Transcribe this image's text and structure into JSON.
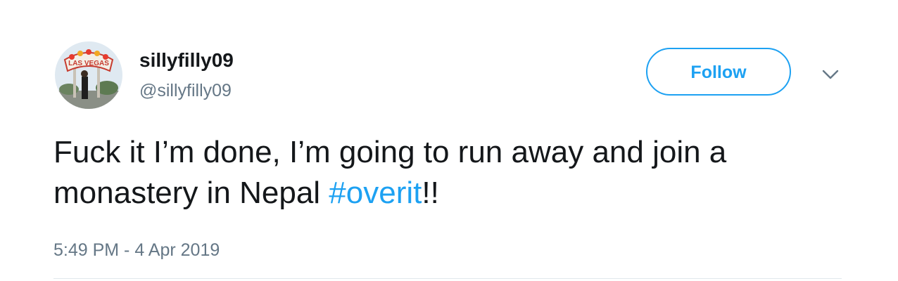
{
  "tweet": {
    "display_name": "sillyfilly09",
    "handle": "@sillyfilly09",
    "follow_label": "Follow",
    "text_before": "Fuck it I’m done, I’m going to run away and join a monastery in Nepal ",
    "hashtag": "#overit",
    "text_after": "!!",
    "timestamp": "5:49 PM - 4 Apr 2019",
    "avatar_sign_text": "LAS VEGAS",
    "caret_icon": "chevron-down-icon"
  },
  "colors": {
    "accent": "#1da1f2",
    "text": "#14171a",
    "secondary": "#657786",
    "divider": "#e1e8ed"
  }
}
